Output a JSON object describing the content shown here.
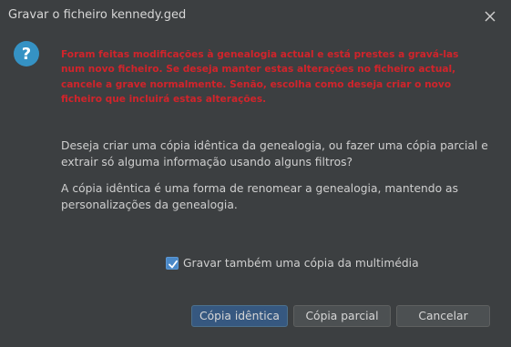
{
  "window": {
    "title": "Gravar o ficheiro kennedy.ged"
  },
  "icons": {
    "dialog_icon": "question-icon",
    "close": "close-icon",
    "check": "checkmark-icon"
  },
  "colors": {
    "warning_text": "#d1242b",
    "default_button": "#365880",
    "icon_blue": "#3592c4"
  },
  "message": {
    "warning": "Foram feitas modificações à genealogia actual e está prestes a gravá-las num novo ficheiro. Se deseja manter estas alterações no ficheiro actual, cancele a grave normalmente. Senão, escolha como deseja criar o novo ficheiro que incluirá estas alterações.",
    "question": "Deseja criar uma cópia idêntica da genealogia, ou fazer uma cópia parcial e extrair só alguma informação usando alguns filtros?",
    "explanation": "A cópia idêntica é uma forma de renomear a genealogia, mantendo as personalizações da genealogia."
  },
  "options": {
    "save_media_label": "Gravar também uma cópia da multimédia",
    "save_media_checked": true
  },
  "buttons": {
    "identical_copy": "Cópia idêntica",
    "partial_copy": "Cópia parcial",
    "cancel": "Cancelar"
  }
}
